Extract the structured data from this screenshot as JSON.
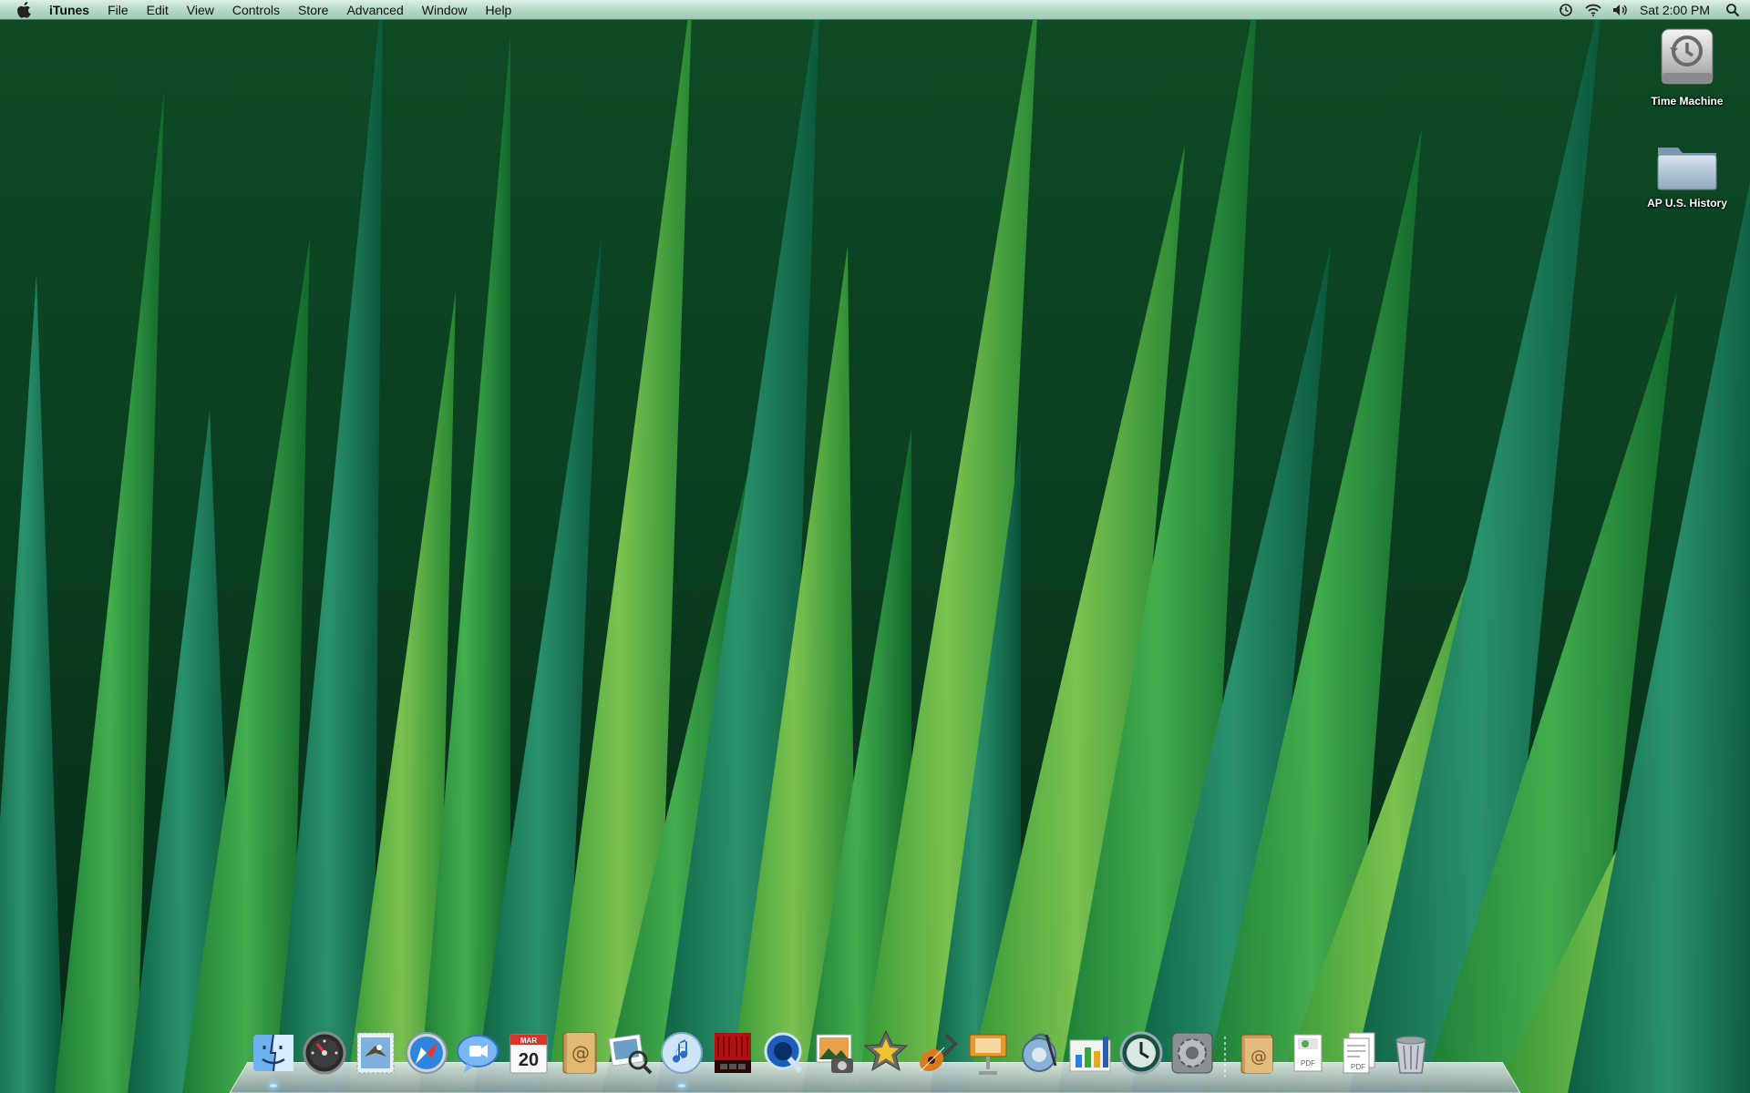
{
  "menubar": {
    "app_name": "iTunes",
    "menus": [
      "File",
      "Edit",
      "View",
      "Controls",
      "Store",
      "Advanced",
      "Window",
      "Help"
    ],
    "clock": "Sat 2:00 PM",
    "status_icons": [
      "time-machine-icon",
      "wifi-icon",
      "volume-icon",
      "spotlight-icon"
    ]
  },
  "desktop": {
    "icons": [
      {
        "label": "Time Machine",
        "icon": "time-machine-drive-icon"
      },
      {
        "label": "AP U.S. History",
        "icon": "folder-icon"
      }
    ]
  },
  "dock": {
    "apps": [
      {
        "name": "Finder",
        "icon": "finder-icon",
        "running": true
      },
      {
        "name": "Dashboard",
        "icon": "dashboard-icon",
        "running": false
      },
      {
        "name": "Mail",
        "icon": "mail-icon",
        "running": false
      },
      {
        "name": "Safari",
        "icon": "safari-icon",
        "running": false
      },
      {
        "name": "iChat",
        "icon": "ichat-icon",
        "running": false
      },
      {
        "name": "iCal",
        "icon": "ical-icon",
        "running": false,
        "month": "MAR",
        "day": "20"
      },
      {
        "name": "Address Book",
        "icon": "address-book-icon",
        "running": false
      },
      {
        "name": "Preview",
        "icon": "preview-icon",
        "running": false
      },
      {
        "name": "iTunes",
        "icon": "itunes-icon",
        "running": true
      },
      {
        "name": "Front Row",
        "icon": "front-row-icon",
        "running": false
      },
      {
        "name": "QuickTime Player",
        "icon": "quicktime-icon",
        "running": false
      },
      {
        "name": "iPhoto",
        "icon": "iphoto-icon",
        "running": false
      },
      {
        "name": "iMovie",
        "icon": "imovie-icon",
        "running": false
      },
      {
        "name": "GarageBand",
        "icon": "garageband-icon",
        "running": false
      },
      {
        "name": "Keynote",
        "icon": "keynote-icon",
        "running": false
      },
      {
        "name": "iWeb",
        "icon": "iweb-icon",
        "running": false
      },
      {
        "name": "Numbers",
        "icon": "numbers-icon",
        "running": false
      },
      {
        "name": "Time Machine",
        "icon": "time-machine-icon",
        "running": false
      },
      {
        "name": "System Preferences",
        "icon": "system-preferences-icon",
        "running": false
      }
    ],
    "stacks": [
      {
        "name": "Documents",
        "icon": "documents-stack-icon"
      },
      {
        "name": "PDF stack",
        "icon": "pdf-stack-icon"
      },
      {
        "name": "Downloads",
        "icon": "downloads-stack-icon"
      },
      {
        "name": "Trash",
        "icon": "trash-icon"
      }
    ]
  },
  "colors": {
    "menubar_top": "#dcefe6",
    "menubar_bottom": "#9cc9b4",
    "grass_dark": "#0b3d1c",
    "grass_light": "#7ed957"
  }
}
